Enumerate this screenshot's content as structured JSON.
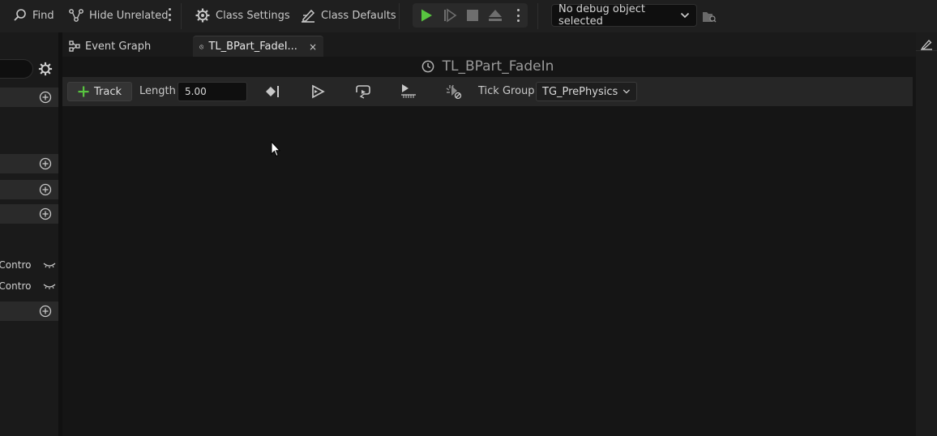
{
  "toolbar": {
    "find_label": "Find",
    "hide_unrelated_label": "Hide Unrelated",
    "class_settings_label": "Class Settings",
    "class_defaults_label": "Class Defaults",
    "debug_object_value": "No debug object selected"
  },
  "left_panel": {
    "vars": [
      {
        "label": "c Contro"
      },
      {
        "label": "c Contro"
      }
    ]
  },
  "tabs": [
    {
      "label": "Event Graph",
      "icon": "graph-icon"
    },
    {
      "label": "TL_BPart_FadeI...",
      "icon": "clock-icon",
      "close": "×"
    }
  ],
  "timeline": {
    "title": "TL_BPart_FadeIn",
    "track_label": "Track",
    "length_label": "Length",
    "length_value": "5.00",
    "tick_group_label": "Tick Group",
    "tick_group_value": "TG_PrePhysics"
  },
  "colors": {
    "accent_green": "#58c440",
    "background": "#151515",
    "toolbar": "#1f1f1f"
  }
}
